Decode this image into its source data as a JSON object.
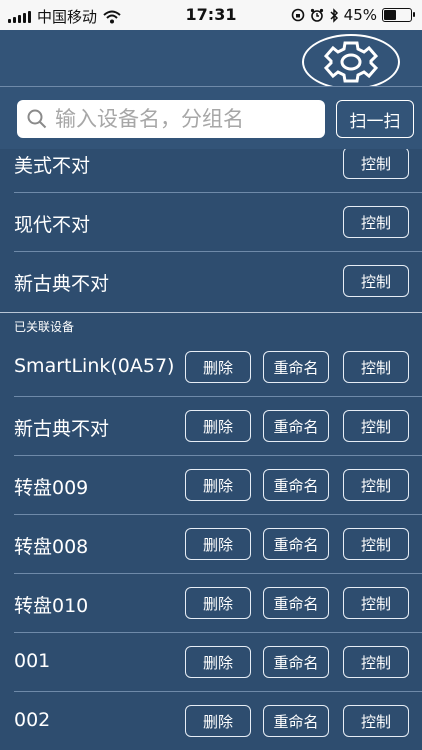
{
  "status_bar": {
    "carrier": "中国移动",
    "time": "17:31",
    "battery_percent": "45%",
    "battery_level": 0.45
  },
  "search": {
    "placeholder": "输入设备名，分组名",
    "scan_label": "扫一扫"
  },
  "sections": {
    "linked_header": "已关联设备"
  },
  "buttons": {
    "delete": "删除",
    "rename": "重命名",
    "control": "控制"
  },
  "unlinked_devices": [
    {
      "name": "美式不对"
    },
    {
      "name": "现代不对"
    },
    {
      "name": "新古典不对"
    }
  ],
  "linked_devices": [
    {
      "name": "SmartLink(0A57)"
    },
    {
      "name": "新古典不对"
    },
    {
      "name": "转盘009"
    },
    {
      "name": "转盘008"
    },
    {
      "name": "转盘010"
    },
    {
      "name": "001"
    },
    {
      "name": "002"
    }
  ],
  "colors": {
    "background": "#2e4d6f",
    "header": "#335478",
    "separator": "#6f8aa9"
  }
}
